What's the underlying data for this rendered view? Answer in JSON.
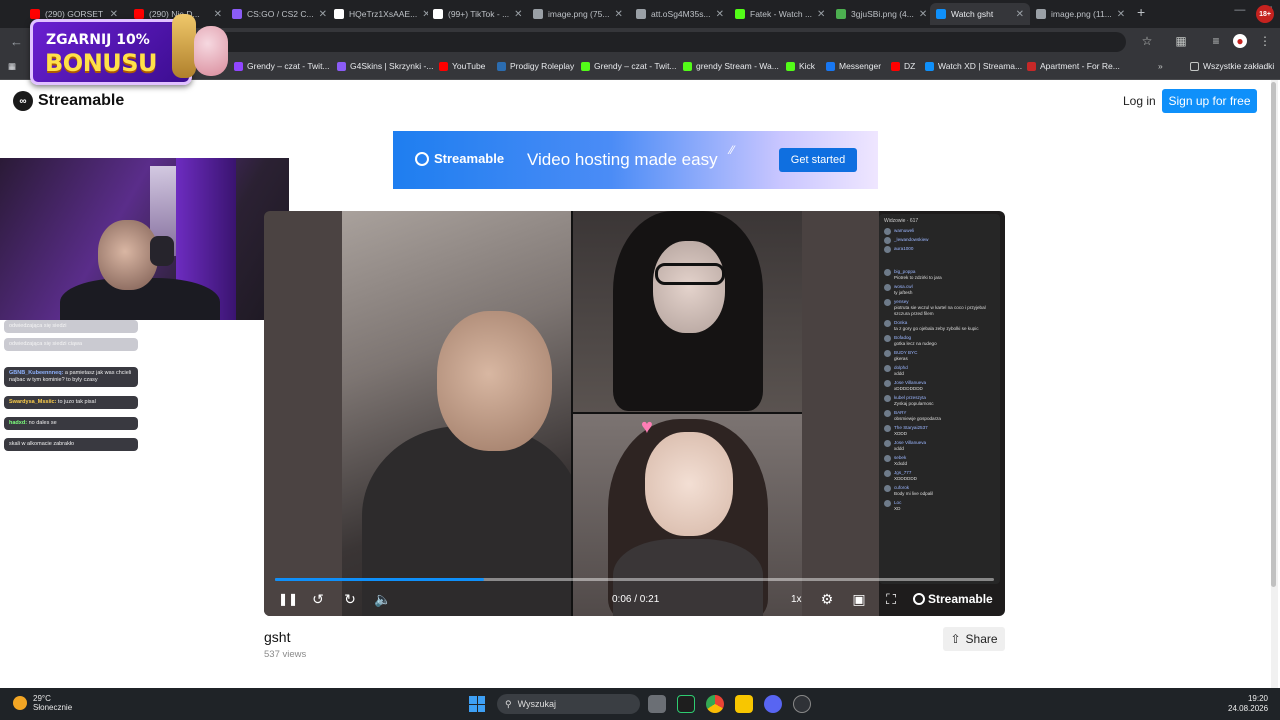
{
  "browser": {
    "tabs": [
      {
        "label": "(290) GORSET",
        "icon": "youtube-icon",
        "color": "#ff0000"
      },
      {
        "label": "(290) Nie D...",
        "icon": "youtube-icon",
        "color": "#ff0000"
      },
      {
        "label": "CS:GO / CS2 C...",
        "icon": "gem-icon",
        "color": "#8b5cf6"
      },
      {
        "label": "HQeTrz1XsAAE...",
        "icon": "x-icon",
        "color": "#ffffff"
      },
      {
        "label": "(99+) TikTok - ...",
        "icon": "tiktok-icon",
        "color": "#ffffff"
      },
      {
        "label": "image.png (75...",
        "icon": "globe-icon",
        "color": "#9aa0a6"
      },
      {
        "label": "att.oSg4M35s...",
        "icon": "globe-icon",
        "color": "#9aa0a6"
      },
      {
        "label": "Fatek - Watch ...",
        "icon": "kick-icon",
        "color": "#53fc18"
      },
      {
        "label": "3gjuSBi.png (4...",
        "icon": "image-icon",
        "color": "#4caf50"
      },
      {
        "label": "Watch gsht",
        "icon": "streamable-icon",
        "color": "#0f90fa"
      },
      {
        "label": "image.png (11...",
        "icon": "globe-icon",
        "color": "#9aa0a6"
      }
    ],
    "bookmarks": [
      {
        "label": "Grendy – czat - Twit...",
        "color": "#9146ff"
      },
      {
        "label": "G4Skins | Skrzynki -...",
        "color": "#8b5cf6"
      },
      {
        "label": "YouTube",
        "color": "#ff0000"
      },
      {
        "label": "Prodigy Roleplay",
        "color": "#2b6cb0"
      },
      {
        "label": "Grendy – czat - Twit...",
        "color": "#53fc18"
      },
      {
        "label": "grendy Stream - Wa...",
        "color": "#53fc18"
      },
      {
        "label": "Kick",
        "color": "#53fc18"
      },
      {
        "label": "Messenger",
        "color": "#1877f2"
      },
      {
        "label": "DZ",
        "color": "#ff0000"
      },
      {
        "label": "Watch XD | Streama...",
        "color": "#0f90fa"
      },
      {
        "label": "Apartment - For Re...",
        "color": "#c62828"
      }
    ],
    "all_bookmarks": "Wszystkie zakładki",
    "profile_badge": "18+"
  },
  "promo": {
    "line1": "ZGARNIJ 10%",
    "line2": "BONUSU"
  },
  "header": {
    "logo": "Streamable",
    "login": "Log in",
    "signup": "Sign up for free"
  },
  "banner": {
    "logo": "Streamable",
    "tagline": "Video hosting made easy",
    "cta": "Get started"
  },
  "stream_chat": [
    {
      "name": "",
      "text": "odwiedzająca się siedzi",
      "faded": true
    },
    {
      "name": "",
      "text": "odwiedzająca się siedzi ciąwa",
      "faded": true
    },
    {
      "name": "GBNB_Kubeennneq:",
      "text": "a pamietasz jak was chcieli najbac w tym kominie? to byly czasy",
      "faded": false
    },
    {
      "name": "Swardysa_Mssiic:",
      "text": "to juzo tak pisal",
      "faded": false
    },
    {
      "name": "hadxd:",
      "text": "no dales se",
      "faded": false
    },
    {
      "name": "",
      "text": "skali w alkomacie zabrakło",
      "faded": false
    }
  ],
  "side_chat": {
    "header": "Widzowie · 617",
    "top": [
      {
        "user": "wamuweli",
        "text": ""
      },
      {
        "user": "_lewandowskiew",
        "text": ""
      },
      {
        "user": "aura1000",
        "text": ""
      }
    ],
    "messages": [
      {
        "user": "big_poppa",
        "text": "Piotrek to zdzirki to jara"
      },
      {
        "user": "wosa.cwl",
        "text": "ty jaftesh"
      },
      {
        "user": "yensey",
        "text": "piotruta sie wczul w kartel na coco i przyjebal szczura przed filem"
      },
      {
        "user": "Donka",
        "text": "ta z gory go ojebala zeby zybolki se kupic"
      },
      {
        "user": "Bofadog",
        "text": "gotka lecz na rudego"
      },
      {
        "user": "BUDY BYC",
        "text": "gkeras"
      },
      {
        "user": "dolphd",
        "text": "xddd"
      },
      {
        "user": "Jose Villanueva",
        "text": "xDDDDDDDD"
      },
      {
        "user": "kubel przeszyta",
        "text": "Zyskaj popularnosc"
      },
      {
        "user": "BARY",
        "text": "obsmiewje gospodarza"
      },
      {
        "user": "The Staryai2537",
        "text": "XDDD"
      },
      {
        "user": "Jose Villanueva",
        "text": "xddd"
      },
      {
        "user": "sebek",
        "text": "Xdxdd"
      },
      {
        "user": "Jgs_777",
        "text": "XDDDDDD"
      },
      {
        "user": "cuforok",
        "text": "Body mi live odpalil"
      },
      {
        "user": "Loc",
        "text": "XD"
      }
    ]
  },
  "player": {
    "time": "0:06 / 0:21",
    "progress": 0.29,
    "speed": "1x",
    "brand": "Streamable"
  },
  "video": {
    "title": "gsht",
    "views": "537 views",
    "share": "Share"
  },
  "taskbar": {
    "temp": "29°C",
    "condition": "Słonecznie",
    "search": "Wyszukaj",
    "time": "19:20",
    "date": "24.08.2026"
  }
}
